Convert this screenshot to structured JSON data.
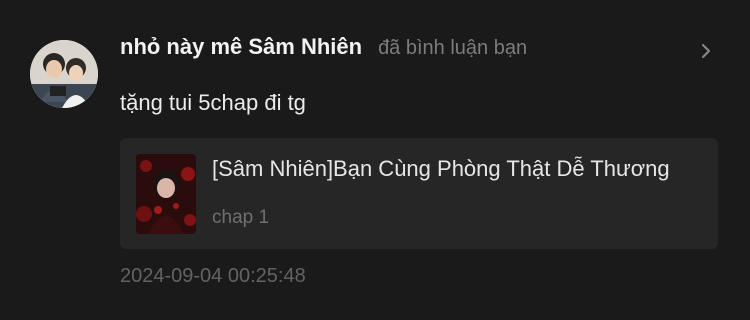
{
  "notification": {
    "username": "nhỏ này mê Sâm Nhiên",
    "action": "đã bình luận bạn",
    "comment": "tặng tui 5chap đi tg",
    "timestamp": "2024-09-04 00:25:48",
    "icons": {
      "avatar": "user-avatar-two-people",
      "chevron": "chevron-right-icon",
      "thumbnail": "comic-cover-thumbnail"
    }
  },
  "card": {
    "title": "[Sâm Nhiên]Bạn Cùng Phòng Thật Dễ Thương",
    "chapter": "chap 1"
  },
  "colors": {
    "background": "#1a1a1a",
    "card_background": "#262626",
    "primary_text": "#f2f2f2",
    "secondary_text": "#7c7c7c"
  }
}
